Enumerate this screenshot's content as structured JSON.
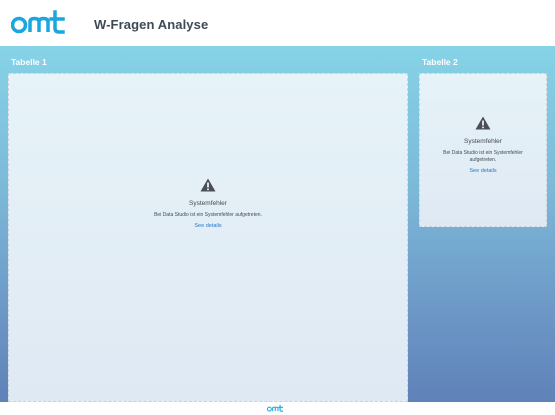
{
  "header": {
    "logo_text": "OMT",
    "title": "W-Fragen Analyse"
  },
  "brand": {
    "logo_color": "#1aa6df"
  },
  "canvas": {
    "gradient_top": "#86d3e6",
    "gradient_bottom": "#5f82b8"
  },
  "panels": [
    {
      "label": "Tabelle 1",
      "error": {
        "icon": "warning-icon",
        "title": "Systemfehler",
        "message": "Bei Data Studio ist ein Systemfehler aufgetreten.",
        "link": "See details"
      }
    },
    {
      "label": "Tabelle 2",
      "error": {
        "icon": "warning-icon",
        "title": "Systemfehler",
        "message": "Bei Data Studio ist ein Systemfehler aufgetreten.",
        "link": "See details"
      }
    }
  ],
  "footer": {
    "logo_text": "OMT"
  }
}
